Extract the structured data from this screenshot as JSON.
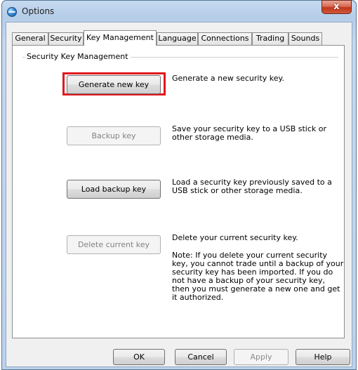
{
  "window": {
    "title": "Options",
    "close_glyph": "x"
  },
  "tabs": [
    {
      "label": "General",
      "active": false
    },
    {
      "label": "Security",
      "active": false
    },
    {
      "label": "Key Management",
      "active": true
    },
    {
      "label": "Language",
      "active": false
    },
    {
      "label": "Connections",
      "active": false
    },
    {
      "label": "Trading",
      "active": false
    },
    {
      "label": "Sounds",
      "active": false
    }
  ],
  "panel": {
    "group_label": "Security Key Management",
    "actions": [
      {
        "button": "Generate new key",
        "enabled": true,
        "highlighted": true,
        "description": "Generate a new security key."
      },
      {
        "button": "Backup key",
        "enabled": false,
        "highlighted": false,
        "description": "Save your security key to a USB stick or other storage media."
      },
      {
        "button": "Load backup key",
        "enabled": true,
        "highlighted": false,
        "description": "Load a security key previously saved to a USB stick or other storage media."
      },
      {
        "button": "Delete current key",
        "enabled": false,
        "highlighted": false,
        "description": "Delete your current security key.",
        "note": "Note: If you delete your current security key, you cannot trade until a backup of your security key has been imported. If you do not have a backup of your security key, then you must generate a new one and get it authorized."
      }
    ]
  },
  "footer": {
    "ok": "OK",
    "cancel": "Cancel",
    "apply": "Apply",
    "help": "Help"
  },
  "colors": {
    "highlight": "#e0181d",
    "title_bar": "#c5daf0",
    "close_button": "#c0381c"
  }
}
